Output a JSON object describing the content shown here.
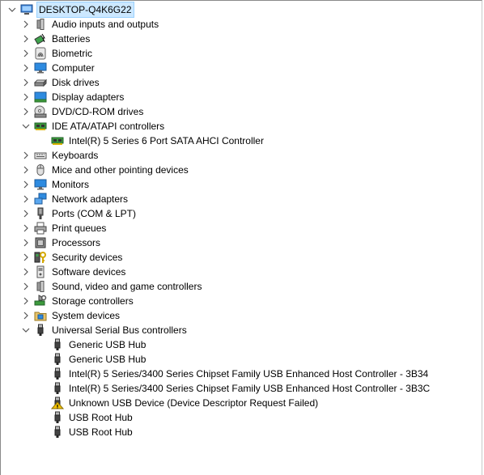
{
  "root": {
    "label": "DESKTOP-Q4K6G22",
    "icon": "computer-icon",
    "expanded": true
  },
  "categories": [
    {
      "label": "Audio inputs and outputs",
      "icon": "speaker-icon",
      "expanded": false
    },
    {
      "label": "Batteries",
      "icon": "battery-icon",
      "expanded": false
    },
    {
      "label": "Biometric",
      "icon": "fingerprint-icon",
      "expanded": false
    },
    {
      "label": "Computer",
      "icon": "monitor-icon",
      "expanded": false
    },
    {
      "label": "Disk drives",
      "icon": "disk-drive-icon",
      "expanded": false
    },
    {
      "label": "Display adapters",
      "icon": "display-adapter-icon",
      "expanded": false
    },
    {
      "label": "DVD/CD-ROM drives",
      "icon": "dvd-drive-icon",
      "expanded": false
    },
    {
      "label": "IDE ATA/ATAPI controllers",
      "icon": "controller-card-icon",
      "expanded": true,
      "children": [
        {
          "label": "Intel(R) 5 Series 6 Port SATA AHCI Controller",
          "icon": "controller-card-icon"
        }
      ]
    },
    {
      "label": "Keyboards",
      "icon": "keyboard-icon",
      "expanded": false
    },
    {
      "label": "Mice and other pointing devices",
      "icon": "mouse-icon",
      "expanded": false
    },
    {
      "label": "Monitors",
      "icon": "monitor-icon",
      "expanded": false
    },
    {
      "label": "Network adapters",
      "icon": "network-icon",
      "expanded": false
    },
    {
      "label": "Ports (COM & LPT)",
      "icon": "port-icon",
      "expanded": false
    },
    {
      "label": "Print queues",
      "icon": "printer-icon",
      "expanded": false
    },
    {
      "label": "Processors",
      "icon": "processor-icon",
      "expanded": false
    },
    {
      "label": "Security devices",
      "icon": "security-key-icon",
      "expanded": false
    },
    {
      "label": "Software devices",
      "icon": "software-device-icon",
      "expanded": false
    },
    {
      "label": "Sound, video and game controllers",
      "icon": "speaker-icon",
      "expanded": false
    },
    {
      "label": "Storage controllers",
      "icon": "storage-controller-icon",
      "expanded": false
    },
    {
      "label": "System devices",
      "icon": "system-folder-icon",
      "expanded": false
    },
    {
      "label": "Universal Serial Bus controllers",
      "icon": "usb-icon",
      "expanded": true,
      "children": [
        {
          "label": "Generic USB Hub",
          "icon": "usb-icon"
        },
        {
          "label": "Generic USB Hub",
          "icon": "usb-icon"
        },
        {
          "label": "Intel(R) 5 Series/3400 Series Chipset Family USB Enhanced Host Controller - 3B34",
          "icon": "usb-icon"
        },
        {
          "label": "Intel(R) 5 Series/3400 Series Chipset Family USB Enhanced Host Controller - 3B3C",
          "icon": "usb-icon"
        },
        {
          "label": "Unknown USB Device (Device Descriptor Request Failed)",
          "icon": "warning-usb-icon"
        },
        {
          "label": "USB Root Hub",
          "icon": "usb-icon"
        },
        {
          "label": "USB Root Hub",
          "icon": "usb-icon"
        }
      ]
    }
  ],
  "colors": {
    "selection": "#cce8ff",
    "chevron": "#555555",
    "warning": "#f5c400"
  }
}
